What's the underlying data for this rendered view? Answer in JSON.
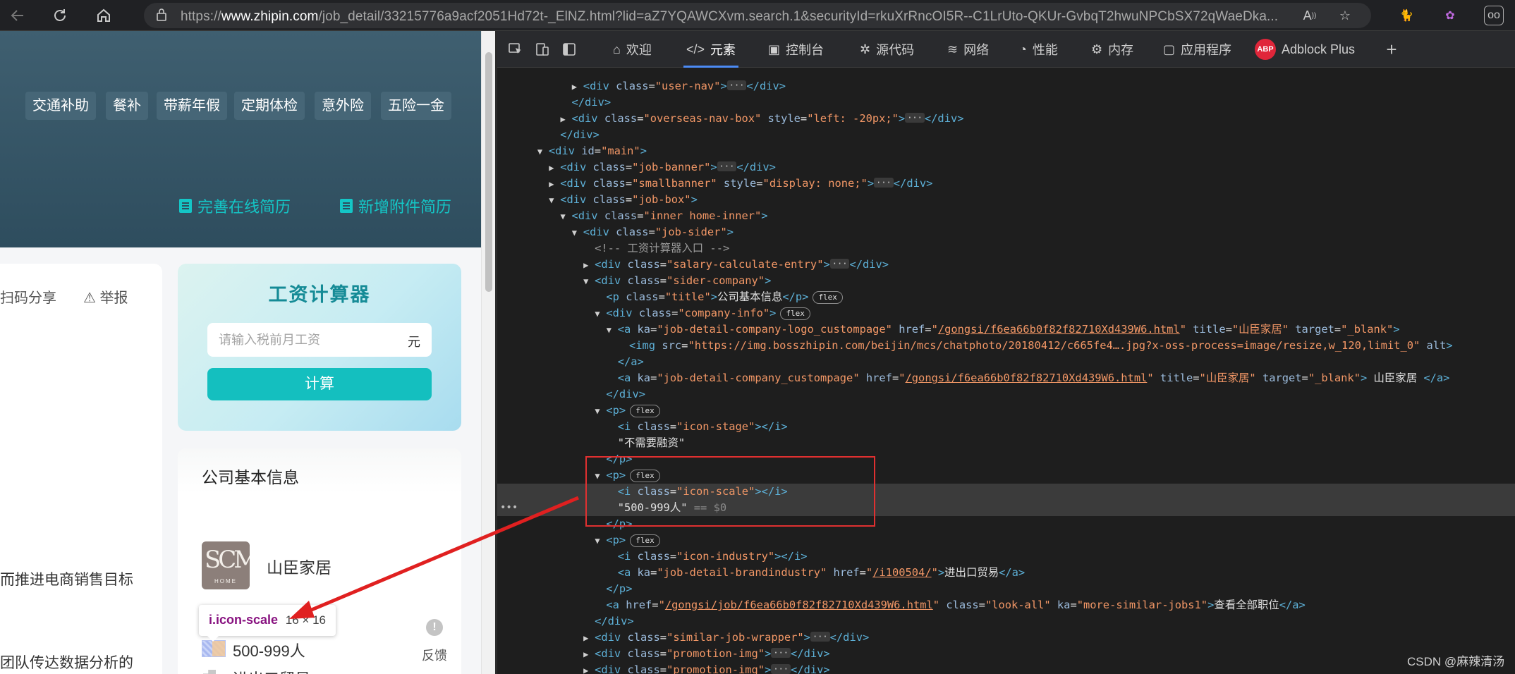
{
  "browser": {
    "url_prefix": "https://",
    "url_domain": "www.zhipin.com",
    "url_path": "/job_detail/33215776a9acf2051Hd72t-_ElNZ.html?lid=aZ7YQAWCXvm.search.1&securityId=rkuXrRncOI5R--C1LrUto-QKUr-GvbqT2hwuNPCbSX72qWaeDka..."
  },
  "page": {
    "tags": [
      "交通补助",
      "餐补",
      "带薪年假",
      "定期体检",
      "意外险",
      "五险一金"
    ],
    "resume_online": "完善在线简历",
    "resume_attach": "新增附件简历",
    "share": "扫码分享",
    "report": "举报",
    "job_line1": "而推进电商销售目标",
    "job_line2": "团队传达数据分析的",
    "salary": {
      "title": "工资计算器",
      "placeholder": "请输入税前月工资",
      "unit": "元",
      "button": "计算"
    },
    "company": {
      "section_title": "公司基本信息",
      "name": "山臣家居",
      "logo_text": "SCM",
      "logo_sub": "HOME",
      "scale": "500-999人",
      "industry": "进出口贸易"
    },
    "tooltip": {
      "selector": "i.icon-scale",
      "size": "16 × 16"
    },
    "feedback": "反馈"
  },
  "devtools": {
    "tabs": [
      "欢迎",
      "元素",
      "控制台",
      "源代码",
      "网络",
      "性能",
      "内存",
      "应用程序",
      "Adblock Plus"
    ],
    "abp": "ABP",
    "lines": [
      {
        "indent": 6,
        "tri": "▶",
        "html": "<span class='t'>&lt;div</span> <span class='a'>class</span>=<span class='v'>\"user-nav\"</span><span class='t'>&gt;</span><span class='ell'>···</span><span class='t'>&lt;/div&gt;</span>"
      },
      {
        "indent": 5,
        "tri": "",
        "html": "<span class='t'>&lt;/div&gt;</span>"
      },
      {
        "indent": 5,
        "tri": "▶",
        "html": "<span class='t'>&lt;div</span> <span class='a'>class</span>=<span class='v'>\"overseas-nav-box\"</span> <span class='a'>style</span>=<span class='v'>\"left: -20px;\"</span><span class='t'>&gt;</span><span class='ell'>···</span><span class='t'>&lt;/div&gt;</span>"
      },
      {
        "indent": 4,
        "tri": "",
        "html": "<span class='t'>&lt;/div&gt;</span>"
      },
      {
        "indent": 3,
        "tri": "▼",
        "html": "<span class='t'>&lt;div</span> <span class='a'>id</span>=<span class='v'>\"main\"</span><span class='t'>&gt;</span>"
      },
      {
        "indent": 4,
        "tri": "▶",
        "html": "<span class='t'>&lt;div</span> <span class='a'>class</span>=<span class='v'>\"job-banner\"</span><span class='t'>&gt;</span><span class='ell'>···</span><span class='t'>&lt;/div&gt;</span>"
      },
      {
        "indent": 4,
        "tri": "▶",
        "html": "<span class='t'>&lt;div</span> <span class='a'>class</span>=<span class='v'>\"smallbanner\"</span> <span class='a'>style</span>=<span class='v'>\"display: none;\"</span><span class='t'>&gt;</span><span class='ell'>···</span><span class='t'>&lt;/div&gt;</span>"
      },
      {
        "indent": 4,
        "tri": "▼",
        "html": "<span class='t'>&lt;div</span> <span class='a'>class</span>=<span class='v'>\"job-box\"</span><span class='t'>&gt;</span>"
      },
      {
        "indent": 5,
        "tri": "▼",
        "html": "<span class='t'>&lt;div</span> <span class='a'>class</span>=<span class='v'>\"inner home-inner\"</span><span class='t'>&gt;</span>"
      },
      {
        "indent": 6,
        "tri": "▼",
        "html": "<span class='t'>&lt;div</span> <span class='a'>class</span>=<span class='v'>\"job-sider\"</span><span class='t'>&gt;</span>"
      },
      {
        "indent": 7,
        "tri": "",
        "html": "<span class='c'>&lt;!-- 工资计算器入口 --&gt;</span>"
      },
      {
        "indent": 7,
        "tri": "▶",
        "html": "<span class='t'>&lt;div</span> <span class='a'>class</span>=<span class='v'>\"salary-calculate-entry\"</span><span class='t'>&gt;</span><span class='ell'>···</span><span class='t'>&lt;/div&gt;</span>"
      },
      {
        "indent": 7,
        "tri": "▼",
        "html": "<span class='t'>&lt;div</span> <span class='a'>class</span>=<span class='v'>\"sider-company\"</span><span class='t'>&gt;</span>"
      },
      {
        "indent": 8,
        "tri": "",
        "html": "<span class='t'>&lt;p</span> <span class='a'>class</span>=<span class='v'>\"title\"</span><span class='t'>&gt;</span><span class='txt'>公司基本信息</span><span class='t'>&lt;/p&gt;</span><span class='badge'>flex</span>"
      },
      {
        "indent": 8,
        "tri": "▼",
        "html": "<span class='t'>&lt;div</span> <span class='a'>class</span>=<span class='v'>\"company-info\"</span><span class='t'>&gt;</span><span class='badge'>flex</span>"
      },
      {
        "indent": 9,
        "tri": "▼",
        "html": "<span class='t'>&lt;a</span> <span class='a'>ka</span>=<span class='v'>\"job-detail-company-logo_custompage\"</span> <span class='a'>href</span>=<span class='v'>\"</span><span class='u'>/gongsi/f6ea66b0f82f82710Xd439W6.html</span><span class='v'>\"</span> <span class='a'>title</span>=<span class='v'>\"山臣家居\"</span> <span class='a'>target</span>=<span class='v'>\"_blank\"</span><span class='t'>&gt;</span>"
      },
      {
        "indent": 10,
        "tri": "",
        "html": "<span class='t'>&lt;img</span> <span class='a'>src</span>=<span class='v'>\"https://img.bosszhipin.com/beijin/mcs/chatphoto/20180412/c665fe4….jpg?x-oss-process=image/resize,w_120,limit_0\"</span> <span class='a'>alt</span><span class='t'>&gt;</span>"
      },
      {
        "indent": 9,
        "tri": "",
        "html": "<span class='t'>&lt;/a&gt;</span>"
      },
      {
        "indent": 9,
        "tri": "",
        "html": "<span class='t'>&lt;a</span> <span class='a'>ka</span>=<span class='v'>\"job-detail-company_custompage\"</span> <span class='a'>href</span>=<span class='v'>\"</span><span class='u'>/gongsi/f6ea66b0f82f82710Xd439W6.html</span><span class='v'>\"</span> <span class='a'>title</span>=<span class='v'>\"山臣家居\"</span> <span class='a'>target</span>=<span class='v'>\"_blank\"</span><span class='t'>&gt;</span><span class='txt'> 山臣家居 </span><span class='t'>&lt;/a&gt;</span>"
      },
      {
        "indent": 8,
        "tri": "",
        "html": "<span class='t'>&lt;/div&gt;</span>"
      },
      {
        "indent": 8,
        "tri": "▼",
        "html": "<span class='t'>&lt;p&gt;</span><span class='badge'>flex</span>"
      },
      {
        "indent": 9,
        "tri": "",
        "html": "<span class='t'>&lt;i</span> <span class='a'>class</span>=<span class='v'>\"icon-stage\"</span><span class='t'>&gt;&lt;/i&gt;</span>"
      },
      {
        "indent": 9,
        "tri": "",
        "html": "<span class='txt'>\"不需要融资\"</span>"
      },
      {
        "indent": 8,
        "tri": "",
        "html": "<span class='t'>&lt;/p&gt;</span>"
      },
      {
        "indent": 8,
        "tri": "▼",
        "html": "<span class='t'>&lt;p&gt;</span><span class='badge'>flex</span>"
      },
      {
        "indent": 9,
        "tri": "",
        "html": "<span class='t'>&lt;i</span> <span class='a'>class</span>=<span class='v'>\"icon-scale\"</span><span class='t'>&gt;&lt;/i&gt;</span>",
        "hl": true
      },
      {
        "indent": 9,
        "tri": "",
        "html": "<span class='txt'>\"500-999人\"</span> <span class='dim2'>== $0</span>",
        "hl": true,
        "dots": true
      },
      {
        "indent": 8,
        "tri": "",
        "html": "<span class='t'>&lt;/p&gt;</span>"
      },
      {
        "indent": 8,
        "tri": "▼",
        "html": "<span class='t'>&lt;p&gt;</span><span class='badge'>flex</span>"
      },
      {
        "indent": 9,
        "tri": "",
        "html": "<span class='t'>&lt;i</span> <span class='a'>class</span>=<span class='v'>\"icon-industry\"</span><span class='t'>&gt;&lt;/i&gt;</span>"
      },
      {
        "indent": 9,
        "tri": "",
        "html": "<span class='t'>&lt;a</span> <span class='a'>ka</span>=<span class='v'>\"job-detail-brandindustry\"</span> <span class='a'>href</span>=<span class='v'>\"</span><span class='u'>/i100504/</span><span class='v'>\"</span><span class='t'>&gt;</span><span class='txt'>进出口贸易</span><span class='t'>&lt;/a&gt;</span>"
      },
      {
        "indent": 8,
        "tri": "",
        "html": "<span class='t'>&lt;/p&gt;</span>"
      },
      {
        "indent": 8,
        "tri": "",
        "html": "<span class='t'>&lt;a</span> <span class='a'>href</span>=<span class='v'>\"</span><span class='u'>/gongsi/job/f6ea66b0f82f82710Xd439W6.html</span><span class='v'>\"</span> <span class='a'>class</span>=<span class='v'>\"look-all\"</span> <span class='a'>ka</span>=<span class='v'>\"more-similar-jobs1\"</span><span class='t'>&gt;</span><span class='txt'>查看全部职位</span><span class='t'>&lt;/a&gt;</span>"
      },
      {
        "indent": 7,
        "tri": "",
        "html": "<span class='t'>&lt;/div&gt;</span>"
      },
      {
        "indent": 7,
        "tri": "▶",
        "html": "<span class='t'>&lt;div</span> <span class='a'>class</span>=<span class='v'>\"similar-job-wrapper\"</span><span class='t'>&gt;</span><span class='ell'>···</span><span class='t'>&lt;/div&gt;</span>"
      },
      {
        "indent": 7,
        "tri": "▶",
        "html": "<span class='t'>&lt;div</span> <span class='a'>class</span>=<span class='v'>\"promotion-img\"</span><span class='t'>&gt;</span><span class='ell'>···</span><span class='t'>&lt;/div&gt;</span>"
      },
      {
        "indent": 7,
        "tri": "▶",
        "html": "<span class='t'>&lt;div</span> <span class='a'>class</span>=<span class='v'>\"promotion-img\"</span><span class='t'>&gt;</span><span class='ell'>···</span><span class='t'>&lt;/div&gt;</span>"
      }
    ]
  },
  "watermark": "CSDN @麻辣清汤"
}
